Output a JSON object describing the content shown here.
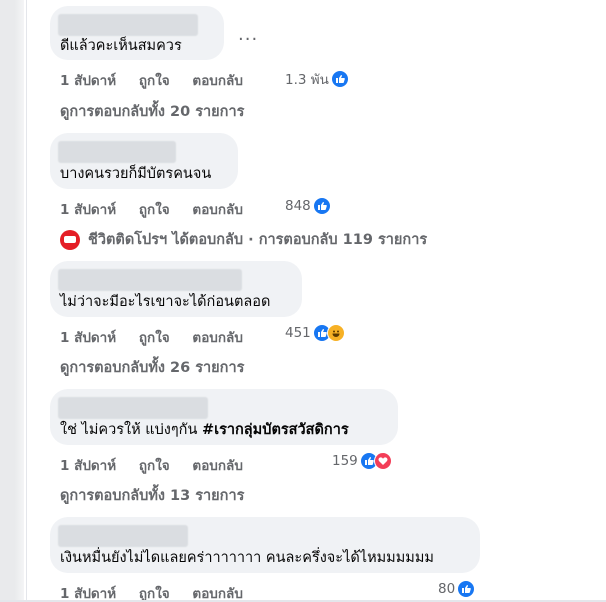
{
  "comments": [
    {
      "text": "ดีแล้วคะเห็นสมควร",
      "time": "1 สัปดาห์",
      "like": "ถูกใจ",
      "reply": "ตอบกลับ",
      "reaction_count": "1.3 พัน",
      "reactions": [
        "like-icon"
      ],
      "replies_link": "ดูการตอบกลับทั้ง 20 รายการ"
    },
    {
      "text": "บางคนรวยก็มีบัตรคนจน",
      "time": "1 สัปดาห์",
      "like": "ถูกใจ",
      "reply": "ตอบกลับ",
      "reaction_count": "848",
      "reactions": [
        "like-icon"
      ],
      "page_reply": "ชีวิตติดโปรฯ ได้ตอบกลับ · การตอบกลับ 119 รายการ"
    },
    {
      "text": "ไม่ว่าจะมีอะไรเขาจะได้ก่อนตลอด",
      "time": "1 สัปดาห์",
      "like": "ถูกใจ",
      "reply": "ตอบกลับ",
      "reaction_count": "451",
      "reactions": [
        "like-icon",
        "haha-icon"
      ],
      "replies_link": "ดูการตอบกลับทั้ง 26 รายการ"
    },
    {
      "text_plain": "ใช่ ไม่ควรให้ แบ่งๆกัน ",
      "text_tag": "#เรากลุ่มบัตรสวัสดิการ",
      "time": "1 สัปดาห์",
      "like": "ถูกใจ",
      "reply": "ตอบกลับ",
      "reaction_count": "159",
      "reactions": [
        "like-icon",
        "love-icon"
      ],
      "replies_link": "ดูการตอบกลับทั้ง 13 รายการ"
    },
    {
      "text": "เงินหมื่นยังไม่ไดแลยคร่าาาาาาา คนละครึ่งจะได้ไหมมมมมม",
      "time": "1 สัปดาห์",
      "like": "ถูกใจ",
      "reply": "ตอบกลับ",
      "reaction_count": "80",
      "reactions": [
        "like-icon"
      ]
    }
  ],
  "more_options": "...",
  "colors": {
    "bubble": "#f0f2f5",
    "meta": "#65676b",
    "like": "#1877f2",
    "love": "#f33e58",
    "haha": "#f7b125",
    "page_avatar": "#e41e26"
  }
}
